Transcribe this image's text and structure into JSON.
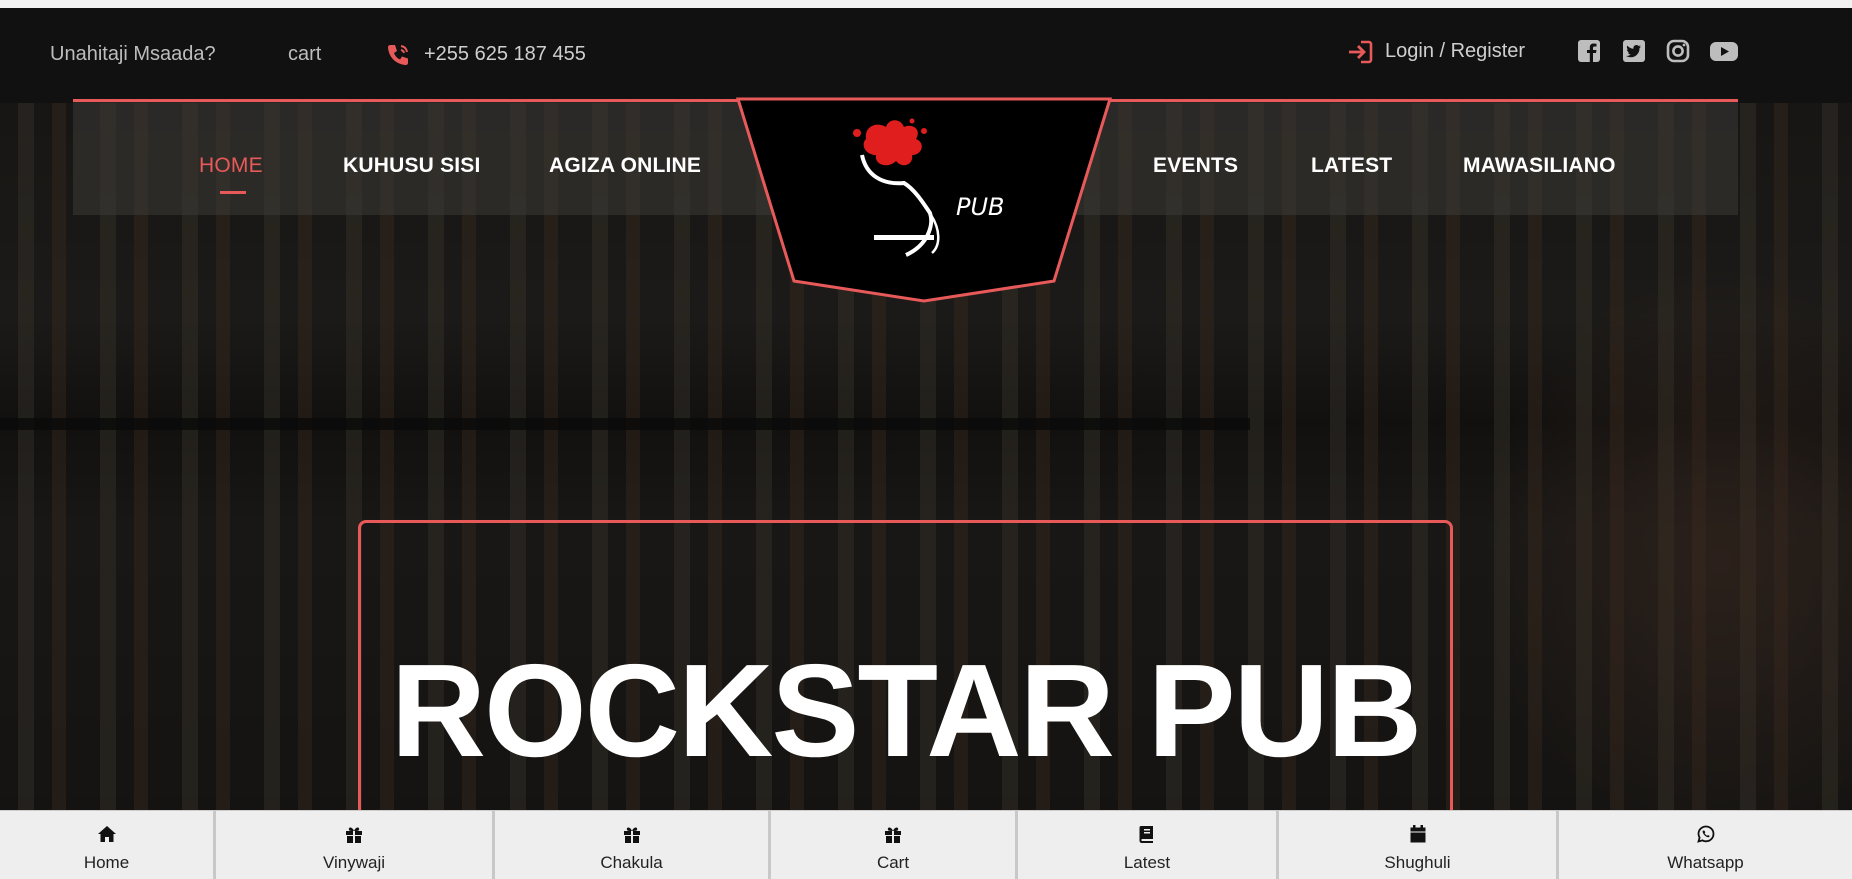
{
  "topbar": {
    "help_text": "Unahitaji Msaada?",
    "cart_text": "cart",
    "phone": "+255 625 187 455",
    "login_text": "Login / Register",
    "phone_icon": "phone-icon",
    "login_icon": "sign-in-icon",
    "social": [
      "facebook-icon",
      "twitter-icon",
      "instagram-icon",
      "youtube-icon"
    ]
  },
  "nav": {
    "left": [
      {
        "label": "HOME",
        "active": true
      },
      {
        "label": "KUHUSU SISI",
        "active": false
      },
      {
        "label": "AGIZA ONLINE",
        "active": false
      }
    ],
    "right": [
      {
        "label": "EVENTS",
        "active": false
      },
      {
        "label": "LATEST",
        "active": false
      },
      {
        "label": "MAWASILIANO",
        "active": false
      }
    ]
  },
  "logo": {
    "text": "PUB"
  },
  "hero": {
    "title": "ROCKSTAR PUB"
  },
  "bottom_nav": [
    {
      "label": "Home",
      "icon": "home-icon"
    },
    {
      "label": "Vinywaji",
      "icon": "gift-icon"
    },
    {
      "label": "Chakula",
      "icon": "gift-icon"
    },
    {
      "label": "Cart",
      "icon": "gift-icon"
    },
    {
      "label": "Latest",
      "icon": "book-icon"
    },
    {
      "label": "Shughuli",
      "icon": "calendar-icon"
    },
    {
      "label": "Whatsapp",
      "icon": "whatsapp-icon"
    }
  ],
  "colors": {
    "accent": "#e85a5a",
    "background": "#111111",
    "bottom_bar": "#eeeeee"
  }
}
